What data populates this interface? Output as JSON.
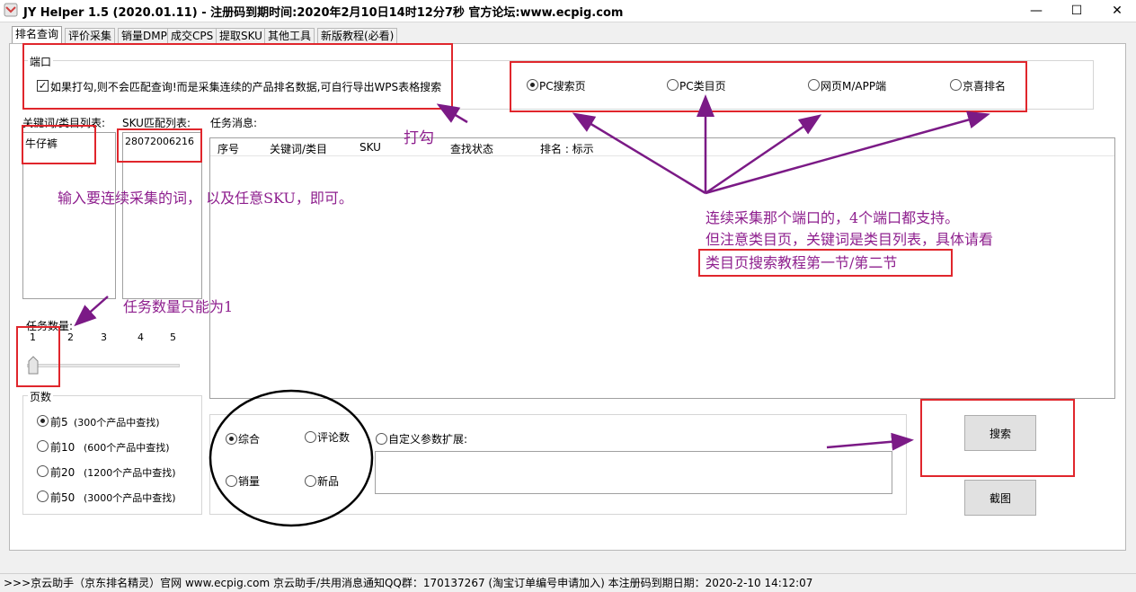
{
  "window": {
    "title": "JY Helper 1.5 (2020.01.11)  - 注册码到期时间:2020年2月10日14时12分7秒   官方论坛:www.ecpig.com",
    "minimize": "—",
    "maximize": "☐",
    "close": "✕"
  },
  "tabs": [
    "排名查询",
    "评价采集",
    "销量DMP",
    "成交CPS",
    "提取SKU",
    "其他工具",
    "新版教程(必看)"
  ],
  "port_group": {
    "label": "端口",
    "checkbox_label": "如果打勾,则不会匹配查询!而是采集连续的产品排名数据,可自行导出WPS表格搜索",
    "checkbox_mark": "✓",
    "options": [
      "PC搜索页",
      "PC类目页",
      "网页M/APP端",
      "京喜排名"
    ],
    "selected": "PC搜索页"
  },
  "keyword_list": {
    "label": "关键词/类目列表:",
    "items": [
      "牛仔裤"
    ]
  },
  "sku_list": {
    "label": "SKU匹配列表:",
    "items": [
      "28072006216"
    ]
  },
  "task_messages": {
    "label": "任务消息:",
    "columns": [
      "序号",
      "关键词/类目",
      "SKU",
      "查找状态",
      "排名 : 标示"
    ]
  },
  "task_count": {
    "label": "任务数量:",
    "ticks": [
      "1",
      "2",
      "3",
      "4",
      "5"
    ],
    "value": 1
  },
  "pages_group": {
    "label": "页数",
    "options": [
      {
        "label": "前5",
        "note": "(300个产品中查找)"
      },
      {
        "label": "前10",
        "note": "(600个产品中查找)"
      },
      {
        "label": "前20",
        "note": "(1200个产品中查找)"
      },
      {
        "label": "前50",
        "note": "(3000个产品中查找)"
      }
    ],
    "selected": "前5"
  },
  "sort_group": {
    "options": [
      "综合",
      "评论数",
      "销量",
      "新品"
    ],
    "selected": "综合",
    "custom_label": "自定义参数扩展:",
    "custom_value": ""
  },
  "buttons": {
    "search": "搜索",
    "screenshot": "截图"
  },
  "annotations": {
    "tick": "打勾",
    "input_hint": "输入要连续采集的词，  以及任意SKU，即可。",
    "task_hint": "任务数量只能为1",
    "port_hint_1": "连续采集那个端口的，4个端口都支持。",
    "port_hint_2": "但注意类目页，关键词是类目列表，具体请看",
    "port_hint_3": "类目页搜索教程第一节/第二节"
  },
  "status_bar": ">>>京云助手（京东排名精灵）官网 www.ecpig.com   京云助手/共用消息通知QQ群：170137267 (淘宝订单编号申请加入)      本注册码到期日期：2020-2-10 14:12:07",
  "colors": {
    "annotation_red": "#e0262c",
    "annotation_purple": "#8e1f8e"
  }
}
